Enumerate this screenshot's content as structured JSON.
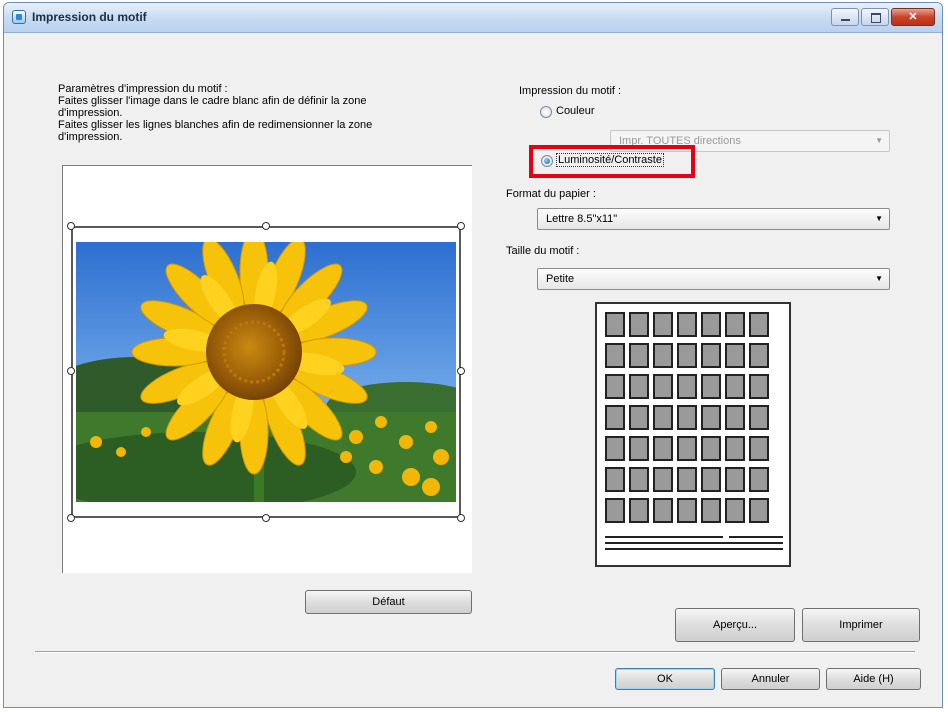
{
  "window": {
    "title": "Impression du motif"
  },
  "left_panel": {
    "instructions": "Paramètres d'impression du motif :\nFaites glisser l'image dans le cadre blanc afin de définir la zone d'impression.\nFaites glisser les lignes blanches afin de redimensionner la zone d'impression.",
    "default_button": "Défaut"
  },
  "right_panel": {
    "pattern_print_label": "Impression du motif :",
    "color_option": "Couleur",
    "color_direction_combo": "Impr. TOUTES directions",
    "brightness_option": "Luminosité/Contraste",
    "selected_option": "Luminosité/Contraste",
    "paper_format_label": "Format du papier :",
    "paper_format_value": "Lettre 8.5\"x11\"",
    "pattern_size_label": "Taille du motif :",
    "pattern_size_value": "Petite"
  },
  "pattern_preview": {
    "columns": 7,
    "rows": 7
  },
  "buttons": {
    "preview": "Aperçu...",
    "print": "Imprimer",
    "ok": "OK",
    "cancel": "Annuler",
    "help": "Aide (H)"
  },
  "colors": {
    "highlight": "#e60012",
    "titlebar": "#c9dcf2",
    "dialog_bg": "#f0f0f0",
    "tile_fill": "#9a9a9a"
  }
}
